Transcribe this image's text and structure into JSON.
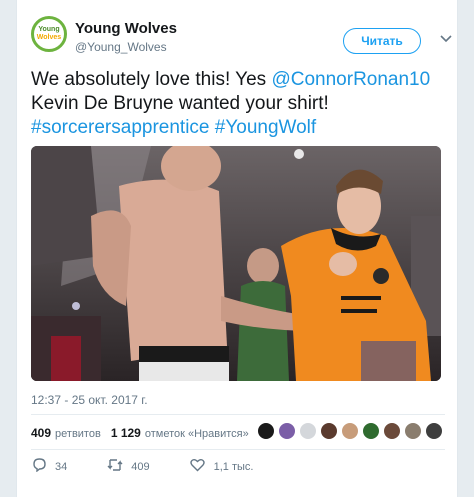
{
  "account": {
    "display_name": "Young Wolves",
    "handle": "@Young_Wolves",
    "avatar_text_top": "Young",
    "avatar_text_bottom": "Wolves"
  },
  "follow_button_label": "Читать",
  "menu_icon": "chevron-down-icon",
  "tweet": {
    "text_intro": "We absolutely love this! Yes ",
    "mention": "@ConnorRonan10",
    "text_middle": " Kevin De Bruyne wanted your shirt! ",
    "hashtag1": "#sorcerersapprentice",
    "hashtag2": "#YoungWolf",
    "timestamp": "12:37 - 25 окт. 2017 г."
  },
  "stats": {
    "retweets_count": "409",
    "retweets_label": "ретвитов",
    "likes_count": "1 129",
    "likes_label": "отметок «Нравится»"
  },
  "likers": [
    "#1a1a1a",
    "#7b5ea7",
    "#d4d7db",
    "#5a3a2e",
    "#c79c7a",
    "#2f6b2f",
    "#6b4a3a",
    "#8a7d6e",
    "#3e3e3e"
  ],
  "actions": {
    "reply_count": "34",
    "retweet_count": "409",
    "like_count": "1,1 тыс."
  },
  "colors": {
    "link": "#1b95e0",
    "follow": "#1da1f2",
    "wolves_orange": "#f2a900"
  }
}
